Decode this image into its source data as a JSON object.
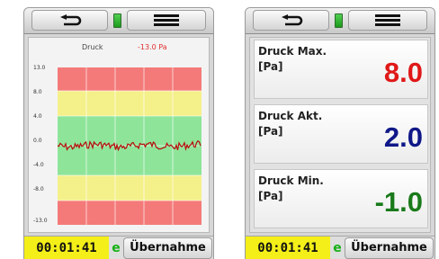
{
  "left_device": {
    "graph": {
      "label": "Druck",
      "value": "-13.0 Pa",
      "y_ticks": [
        "13.0",
        "8.0",
        "4.0",
        "0.0",
        "-4.0",
        "-8.0",
        "-13.0"
      ]
    },
    "timer": "00:01:41",
    "e_icon": "e",
    "accept_label": "Übernahme"
  },
  "right_device": {
    "cells": [
      {
        "label": "Druck Max.\n[Pa]",
        "value": "8.0",
        "color": "#e01818"
      },
      {
        "label": "Druck Akt.\n[Pa]",
        "value": "2.0",
        "color": "#101888"
      },
      {
        "label": "Druck Min.\n[Pa]",
        "value": "-1.0",
        "color": "#1a7a1a"
      }
    ],
    "timer": "00:01:41",
    "e_icon": "e",
    "accept_label": "Übernahme"
  },
  "icons": {
    "back": "back-arrow-icon",
    "menu": "hamburger-menu-icon",
    "battery": "battery-icon"
  },
  "colors": {
    "zone_red": "#f47a7a",
    "zone_yellow": "#f4f08a",
    "zone_green": "#8ee59a",
    "signal": "#b80a0a"
  }
}
